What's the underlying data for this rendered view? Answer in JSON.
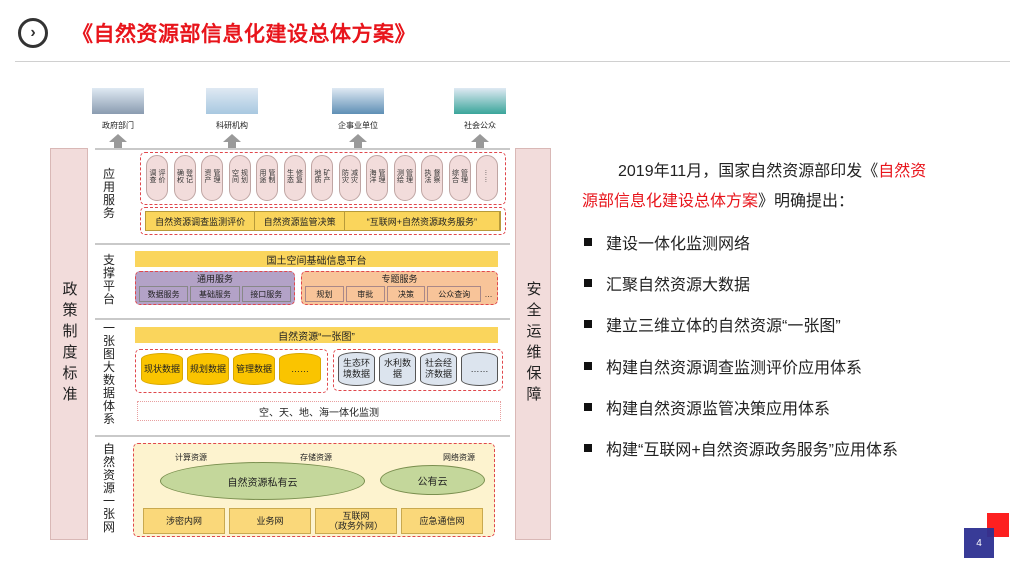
{
  "header": {
    "title": "《自然资源部信息化建设总体方案》",
    "icon": "chevron-right-circle-icon"
  },
  "diagram": {
    "left_column": "政策制度标准",
    "right_column": "安全运维保障",
    "entities": [
      {
        "label": "政府部门"
      },
      {
        "label": "科研机构"
      },
      {
        "label": "企事业单位"
      },
      {
        "label": "社会公众"
      }
    ],
    "app_layer": {
      "label": "应用服务",
      "services": [
        "调查评价",
        "确权登记",
        "资产管理",
        "空间规划",
        "用途管制",
        "生态修复",
        "地质矿产",
        "防灾减灾",
        "海洋管理",
        "测绘管理",
        "执法督察",
        "综合管理",
        "……"
      ],
      "bar": [
        "自然资源调查监测评价",
        "自然资源监管决策",
        "“互联网+自然资源政务服务”"
      ]
    },
    "support_layer": {
      "label": "支撑平台",
      "platform": "国土空间基础信息平台",
      "general": {
        "title": "通用服务",
        "items": [
          "数据服务",
          "基础服务",
          "接口服务"
        ]
      },
      "thematic": {
        "title": "专题服务",
        "items": [
          "规划",
          "审批",
          "决策",
          "公众查询",
          "…"
        ]
      }
    },
    "map_layer": {
      "label": "一张图大数据体系",
      "bar": "自然资源“一张图”",
      "own_data": [
        "现状数据",
        "规划数据",
        "管理数据",
        "……"
      ],
      "other_data": [
        "生态环境数据",
        "水利数据",
        "社会经济数据",
        "……"
      ],
      "monitoring": "空、天、地、海一体化监测"
    },
    "net_layer": {
      "label": "自然资源一张网",
      "resources": [
        "计算资源",
        "存储资源",
        "网络资源"
      ],
      "clouds": [
        "自然资源私有云",
        "公有云"
      ],
      "networks": [
        "涉密内网",
        "业务网",
        "互联网\n（政务外网）",
        "应急通信网"
      ]
    }
  },
  "content": {
    "intro_pre": "2019年11月，国家自然资源部印发《",
    "intro_red": "自然资源部信息化建设总体方案",
    "intro_post": "》明确提出：",
    "bullets": [
      "建设一体化监测网络",
      "汇聚自然资源大数据",
      "建立三维立体的自然资源“一张图”",
      "构建自然资源调查监测评价应用体系",
      "构建自然资源监管决策应用体系",
      "构建“互联网+自然资源政务服务”应用体系"
    ]
  },
  "page_number": "4",
  "colors": {
    "title": "#e8141b",
    "page_badge": "#2e3192",
    "accent": "#fd2020"
  }
}
